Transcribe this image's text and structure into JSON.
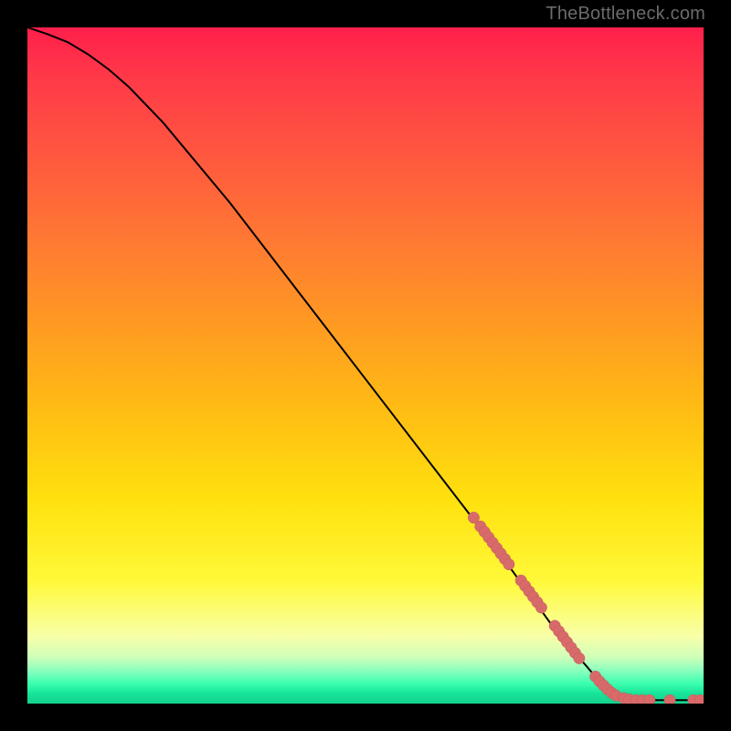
{
  "watermark": "TheBottleneck.com",
  "colors": {
    "curve": "#000000",
    "points": "#d86a6a",
    "points_stroke": "#c25d5d"
  },
  "chart_data": {
    "type": "line",
    "title": "",
    "xlabel": "",
    "ylabel": "",
    "xlim": [
      0,
      100
    ],
    "ylim": [
      0,
      100
    ],
    "grid": false,
    "legend": false,
    "curve": [
      {
        "x": 0,
        "y": 100
      },
      {
        "x": 3,
        "y": 99
      },
      {
        "x": 6,
        "y": 97.8
      },
      {
        "x": 9,
        "y": 96
      },
      {
        "x": 12,
        "y": 93.8
      },
      {
        "x": 15,
        "y": 91.2
      },
      {
        "x": 20,
        "y": 86
      },
      {
        "x": 30,
        "y": 74
      },
      {
        "x": 40,
        "y": 61
      },
      {
        "x": 50,
        "y": 48
      },
      {
        "x": 60,
        "y": 35
      },
      {
        "x": 70,
        "y": 22
      },
      {
        "x": 78,
        "y": 11
      },
      {
        "x": 84,
        "y": 4
      },
      {
        "x": 87,
        "y": 1.5
      },
      {
        "x": 90,
        "y": 0.5
      },
      {
        "x": 100,
        "y": 0.5
      }
    ],
    "points": [
      {
        "x": 66,
        "y": 27.5
      },
      {
        "x": 67,
        "y": 26.2
      },
      {
        "x": 67.6,
        "y": 25.4
      },
      {
        "x": 68.2,
        "y": 24.6
      },
      {
        "x": 68.8,
        "y": 23.8
      },
      {
        "x": 69.4,
        "y": 23.0
      },
      {
        "x": 70.0,
        "y": 22.2
      },
      {
        "x": 70.6,
        "y": 21.4
      },
      {
        "x": 71.2,
        "y": 20.6
      },
      {
        "x": 73.0,
        "y": 18.2
      },
      {
        "x": 73.6,
        "y": 17.4
      },
      {
        "x": 74.2,
        "y": 16.6
      },
      {
        "x": 74.8,
        "y": 15.8
      },
      {
        "x": 75.4,
        "y": 15.0
      },
      {
        "x": 76.0,
        "y": 14.2
      },
      {
        "x": 78.0,
        "y": 11.5
      },
      {
        "x": 78.6,
        "y": 10.7
      },
      {
        "x": 79.2,
        "y": 9.9
      },
      {
        "x": 79.8,
        "y": 9.1
      },
      {
        "x": 80.4,
        "y": 8.3
      },
      {
        "x": 81.0,
        "y": 7.5
      },
      {
        "x": 81.6,
        "y": 6.7
      },
      {
        "x": 84.0,
        "y": 4.0
      },
      {
        "x": 84.6,
        "y": 3.3
      },
      {
        "x": 85.2,
        "y": 2.7
      },
      {
        "x": 85.8,
        "y": 2.1
      },
      {
        "x": 86.4,
        "y": 1.6
      },
      {
        "x": 87.0,
        "y": 1.2
      },
      {
        "x": 88.2,
        "y": 0.8
      },
      {
        "x": 89.0,
        "y": 0.6
      },
      {
        "x": 90.0,
        "y": 0.5
      },
      {
        "x": 91.0,
        "y": 0.5
      },
      {
        "x": 92.0,
        "y": 0.5
      },
      {
        "x": 95.0,
        "y": 0.5
      },
      {
        "x": 98.5,
        "y": 0.5
      },
      {
        "x": 99.5,
        "y": 0.5
      }
    ]
  }
}
